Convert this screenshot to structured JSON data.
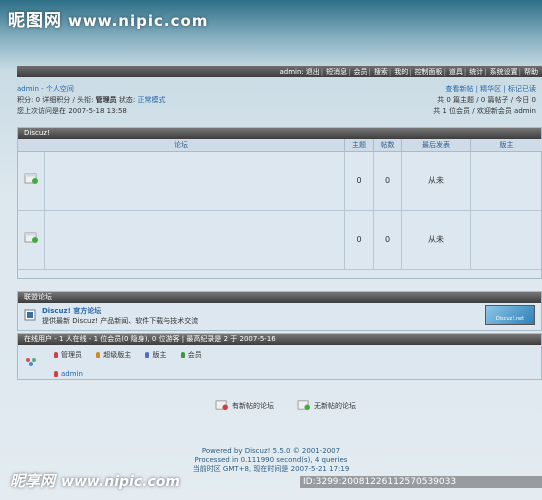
{
  "watermark": {
    "logo": "昵图网",
    "url": "www.nipic.com",
    "bottom_logo": "昵享网",
    "bottom_url": "www.nipic.com",
    "id_text": "ID:3299:20081226112570539033"
  },
  "topbar": {
    "items": [
      "admin:",
      "退出",
      "短消息",
      "会员",
      "搜索",
      "我的",
      "控制面板",
      "道具",
      "统计",
      "系统设置",
      "帮助"
    ]
  },
  "user": {
    "name": "admin",
    "space": "- 个人空间",
    "line2_prefix": "积分: 0 详细积分 / 头衔:",
    "title": "管理员",
    "state_label": "状态:",
    "state": "正常模式",
    "last_visit": "您上次访问是在 2007-5-18 13:58"
  },
  "stats": {
    "links": "查看新帖 | 精华区 | 标记已读",
    "line2": "共 0 篇主题 / 0 篇帖子 / 今日 0",
    "line3": "共 1 位会员 / 欢迎新会员 admin"
  },
  "forum": {
    "category": "Discuz!",
    "headers": {
      "forum": "论坛",
      "topics": "主题",
      "posts": "帖数",
      "last": "最后发表",
      "mods": "版主"
    },
    "rows": [
      {
        "topics": "0",
        "posts": "0",
        "last": "从未"
      },
      {
        "topics": "0",
        "posts": "0",
        "last": "从未"
      }
    ]
  },
  "links": {
    "header": "联盟论坛",
    "name": "Discuz! 官方论坛",
    "desc": "提供最新 Discuz! 产品新闻、软件下载与技术交流",
    "logo_text": "Discuz!.net"
  },
  "online": {
    "header": "在线用户 - 1 人在线 - 1 位会员(0 隐身), 0 位游客 | 最高纪录是 2 于 2007-5-16",
    "legend": [
      "管理员",
      "超级版主",
      "版主",
      "会员"
    ],
    "legend_colors": [
      "#d04040",
      "#d08a20",
      "#4d6fc9",
      "#3a9a3a"
    ],
    "users": [
      "admin"
    ]
  },
  "legend_bottom": {
    "new": "有新帖的论坛",
    "none": "无新帖的论坛"
  },
  "footer": {
    "powered": "Powered by Discuz! 5.5.0 © 2001-2007",
    "processed": "Processed in 0.111990 second(s), 4 queries",
    "time": "当前时区 GMT+8, 现在时间是 2007-5-21 17:19"
  }
}
